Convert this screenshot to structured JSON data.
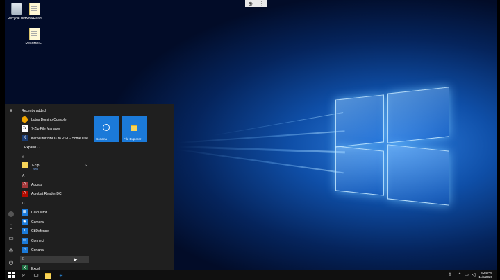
{
  "desktop": {
    "icons": [
      {
        "label": "Recycle Bin"
      },
      {
        "label": "WorkRead..."
      },
      {
        "label": "ReadMeIF..."
      }
    ]
  },
  "zoom_icon": "magnifier-plus-icon",
  "start_menu": {
    "recently_added_title": "Recently added",
    "recent": [
      {
        "label": "Lotus Domino Console",
        "color": "#f0a500"
      },
      {
        "label": "7-Zip File Manager",
        "color": "#000000"
      },
      {
        "label": "Kernel for NBOX to PST - Home Use...",
        "color": "#1a3c73"
      }
    ],
    "expand_label": "Expand",
    "groups": [
      {
        "letter": "#",
        "apps": [
          {
            "label": "7-Zip",
            "sub": "New"
          }
        ]
      },
      {
        "letter": "A",
        "apps": [
          {
            "label": "Access"
          },
          {
            "label": "Acrobat Reader DC"
          }
        ]
      },
      {
        "letter": "C",
        "apps": [
          {
            "label": "Calculator"
          },
          {
            "label": "Camera"
          },
          {
            "label": "CbDefense"
          },
          {
            "label": "Connect"
          },
          {
            "label": "Cortana"
          }
        ]
      },
      {
        "letter": "E",
        "apps": [
          {
            "label": "Excel"
          }
        ]
      }
    ],
    "tiles": [
      {
        "label": "Cortana"
      },
      {
        "label": "File Explorer"
      }
    ]
  },
  "taskbar": {
    "time": "8:24 PM",
    "date": "11/5/2020"
  },
  "colors": {
    "accent": "#1b7ad9",
    "start_bg": "#1f1f1f",
    "taskbar_bg": "#101010"
  }
}
